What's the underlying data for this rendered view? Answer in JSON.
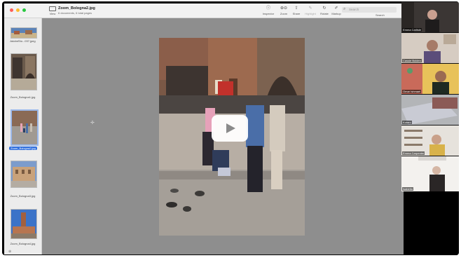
{
  "window": {
    "title": "Zoom_Bologna2.jpg",
    "subtitle": "6 documents, 6 total pages",
    "view_label": "View",
    "traffic_lights": [
      "#ff5f57",
      "#febc2e",
      "#28c840"
    ]
  },
  "toolbar": {
    "tools": [
      {
        "label": "Inspector",
        "icon": "info-icon",
        "glyph": "ⓘ"
      },
      {
        "label": "Zoom",
        "icon": "zoom-icon",
        "glyph": "⊕⊖"
      },
      {
        "label": "Share",
        "icon": "share-icon",
        "glyph": "⇪"
      },
      {
        "label": "Highlight",
        "icon": "highlight-icon",
        "glyph": "✎"
      },
      {
        "label": "Rotate",
        "icon": "rotate-icon",
        "glyph": "↻"
      },
      {
        "label": "Markup",
        "icon": "markup-icon",
        "glyph": "✐"
      }
    ],
    "search_placeholder": "Search",
    "search_label": "Search"
  },
  "sidebar": {
    "items": [
      {
        "label": "AdobeSto...037.jpeg",
        "selected": false
      },
      {
        "label": "Zoom_Bologna1.jpg",
        "selected": false
      },
      {
        "label": "Zoom_Bologna2.jpg",
        "selected": true
      },
      {
        "label": "Zoom_Bologna3.jpg",
        "selected": false
      },
      {
        "label": "Zoom_Bologna4.jpg",
        "selected": false
      }
    ],
    "selected_color": "#2f6fde"
  },
  "participants": [
    {
      "name": "Emma Carlisle"
    },
    {
      "name": "Cassie Bolden"
    },
    {
      "name": "Omar Ishmael"
    },
    {
      "name": "Kotaro"
    },
    {
      "name": "Emma Carpenter"
    },
    {
      "name": "Isabella"
    }
  ],
  "play_button": {
    "icon": "play-icon"
  }
}
